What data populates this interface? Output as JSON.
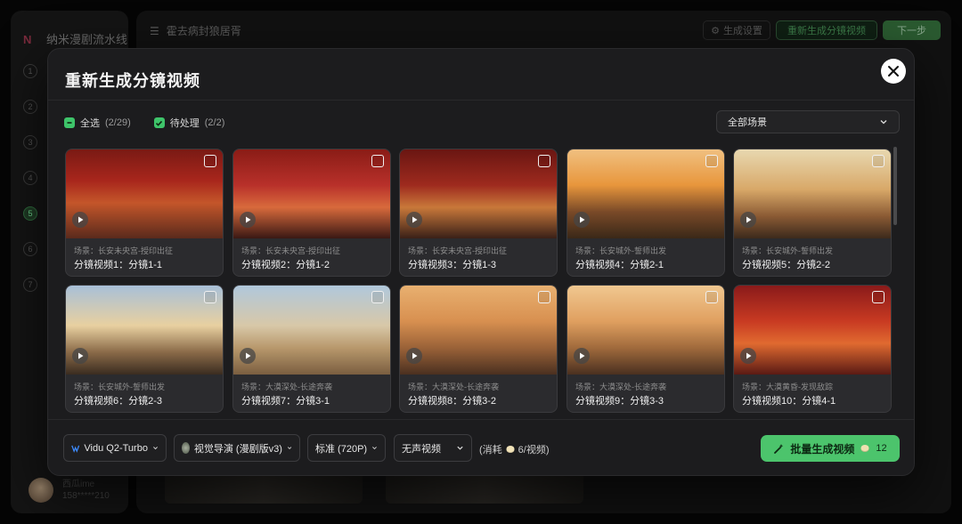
{
  "app": {
    "brand": "纳米漫剧流水线",
    "project_title": "霍去病封狼居胥",
    "top_buttons": {
      "settings": "生成设置",
      "regenerate": "重新生成分镜视频",
      "next": "下一步"
    },
    "steps": [
      "1",
      "2",
      "3",
      "4",
      "5",
      "6",
      "7"
    ],
    "user": {
      "name": "西瓜ime",
      "phone": "158*****210"
    }
  },
  "modal": {
    "title": "重新生成分镜视频",
    "select_all_label": "全选",
    "select_all_count": "(2/29)",
    "pending_label": "待处理",
    "pending_count": "(2/2)",
    "scene_filter": "全部场景",
    "cards": [
      {
        "scene": "场景：长安未央宫-授印出征",
        "name": "分镜视频1：分镜1-1"
      },
      {
        "scene": "场景：长安未央宫-授印出征",
        "name": "分镜视频2：分镜1-2"
      },
      {
        "scene": "场景：长安未央宫-授印出征",
        "name": "分镜视频3：分镜1-3"
      },
      {
        "scene": "场景：长安城外-誓师出发",
        "name": "分镜视频4：分镜2-1"
      },
      {
        "scene": "场景：长安城外-誓师出发",
        "name": "分镜视频5：分镜2-2"
      },
      {
        "scene": "场景：长安城外-誓师出发",
        "name": "分镜视频6：分镜2-3"
      },
      {
        "scene": "场景：大漠深处-长途奔袭",
        "name": "分镜视频7：分镜3-1"
      },
      {
        "scene": "场景：大漠深处-长途奔袭",
        "name": "分镜视频8：分镜3-2"
      },
      {
        "scene": "场景：大漠深处-长途奔袭",
        "name": "分镜视频9：分镜3-3"
      },
      {
        "scene": "场景：大漠黄昏-发现敌踪",
        "name": "分镜视频10：分镜4-1"
      }
    ],
    "controls": {
      "model": "Vidu Q2-Turbo",
      "director": "视觉导演 (漫剧版v3)",
      "quality": "标准 (720P)",
      "audio": "无声视频",
      "cost_prefix": "(消耗",
      "cost_value": "6/视频)"
    },
    "batch_button": "批量生成视频",
    "batch_count": "12"
  }
}
